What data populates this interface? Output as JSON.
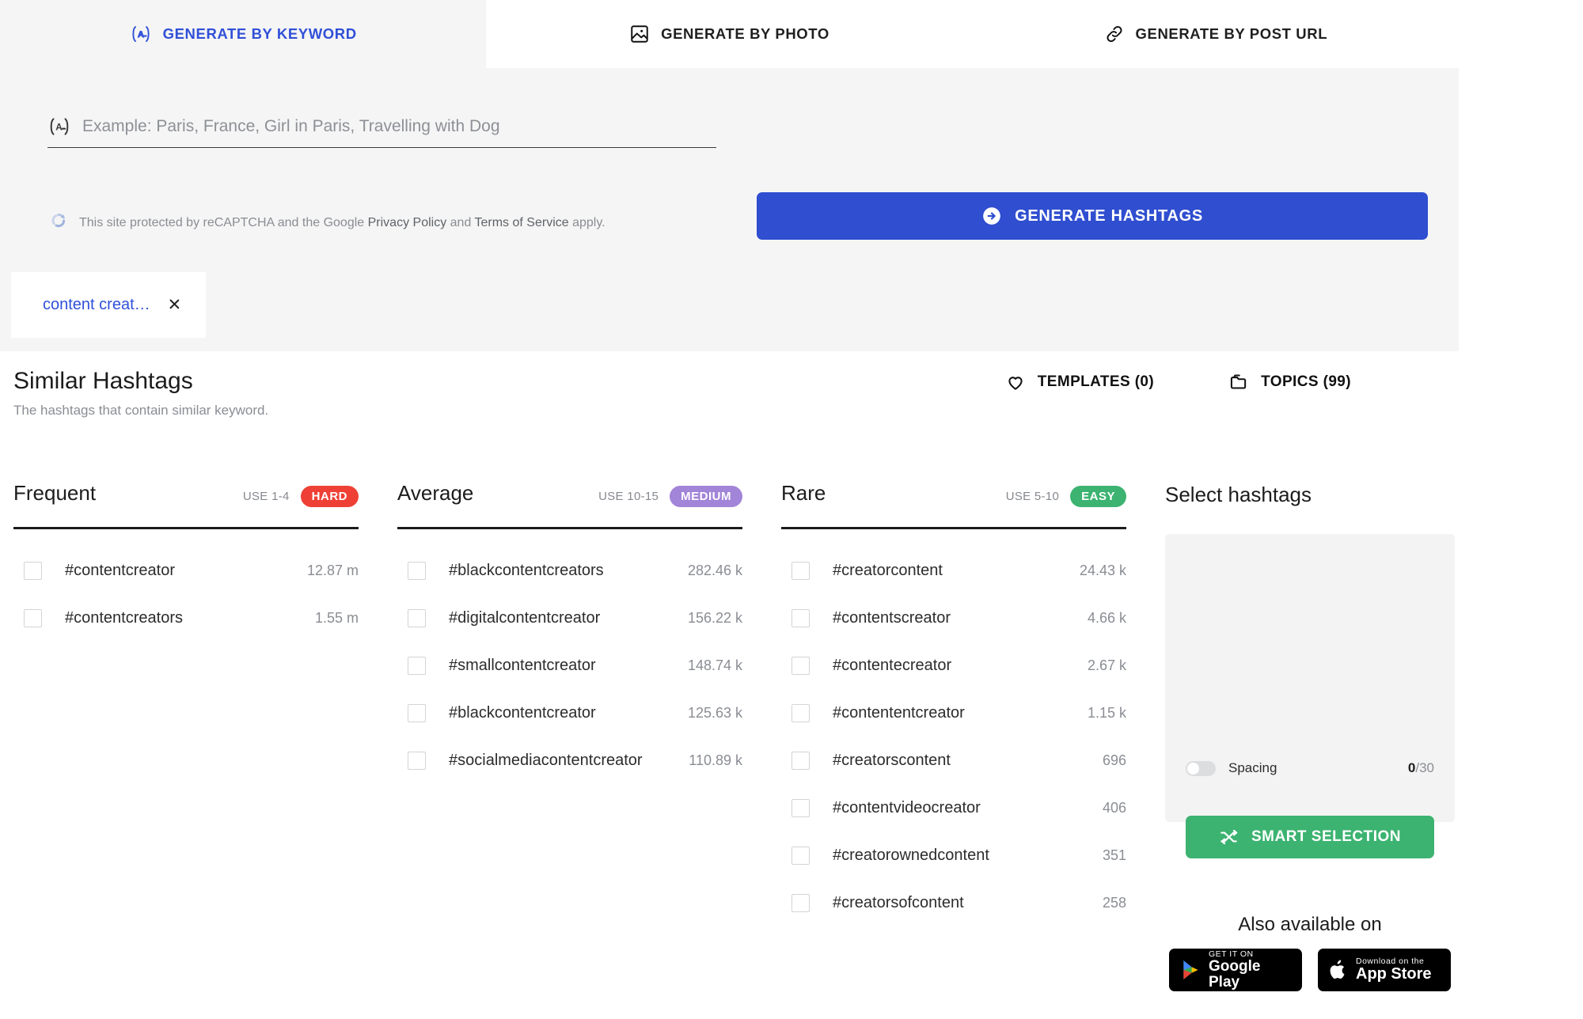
{
  "tabs": [
    {
      "label": "GENERATE BY KEYWORD",
      "icon": "keyword-icon",
      "active": true
    },
    {
      "label": "GENERATE BY PHOTO",
      "icon": "photo-icon",
      "active": false
    },
    {
      "label": "GENERATE BY POST URL",
      "icon": "link-icon",
      "active": false
    }
  ],
  "search": {
    "placeholder": "Example: Paris, France, Girl in Paris, Travelling with Dog",
    "value": "",
    "icon": "keyword-icon",
    "generate_label": "GENERATE HASHTAGS",
    "generate_icon": "arrow-right-circle-icon",
    "recaptcha": {
      "icon": "recaptcha-icon",
      "prefix": "This site protected by reCAPTCHA and the Google ",
      "privacy": "Privacy Policy",
      "middle": " and ",
      "terms": "Terms of Service",
      "suffix": " apply."
    }
  },
  "keyword_chip": {
    "label": "content creat…",
    "close_icon": "close-icon"
  },
  "results": {
    "title": "Similar Hashtags",
    "subtitle": "The hashtags that contain similar keyword.",
    "actions": [
      {
        "label": "TEMPLATES (0)",
        "icon": "heart-icon"
      },
      {
        "label": "TOPICS (99)",
        "icon": "folder-icon"
      }
    ]
  },
  "columns": [
    {
      "name": "Frequent",
      "use": "USE 1-4",
      "badge": "HARD",
      "badge_color": "#ef4035",
      "tags": [
        {
          "name": "#contentcreator",
          "count": "12.87 m"
        },
        {
          "name": "#contentcreators",
          "count": "1.55 m"
        }
      ]
    },
    {
      "name": "Average",
      "use": "USE 10-15",
      "badge": "MEDIUM",
      "badge_color": "#a284d8",
      "tags": [
        {
          "name": "#blackcontentcreators",
          "count": "282.46 k"
        },
        {
          "name": "#digitalcontentcreator",
          "count": "156.22 k"
        },
        {
          "name": "#smallcontentcreator",
          "count": "148.74 k"
        },
        {
          "name": "#blackcontentcreator",
          "count": "125.63 k"
        },
        {
          "name": "#socialmediacontentcreator",
          "count": "110.89 k"
        }
      ]
    },
    {
      "name": "Rare",
      "use": "USE 5-10",
      "badge": "EASY",
      "badge_color": "#3cb371",
      "tags": [
        {
          "name": "#creatorcontent",
          "count": "24.43 k"
        },
        {
          "name": "#contentscreator",
          "count": "4.66 k"
        },
        {
          "name": "#contentecreator",
          "count": "2.67 k"
        },
        {
          "name": "#contententcreator",
          "count": "1.15 k"
        },
        {
          "name": "#creatorscontent",
          "count": "696"
        },
        {
          "name": "#contentvideocreator",
          "count": "406"
        },
        {
          "name": "#creatorownedcontent",
          "count": "351"
        },
        {
          "name": "#creatorsofcontent",
          "count": "258"
        }
      ]
    }
  ],
  "select_panel": {
    "title": "Select hashtags",
    "spacing_label": "Spacing",
    "counter_current": "0",
    "counter_total": "/30",
    "smart_label": "SMART SELECTION",
    "smart_icon": "shuffle-icon",
    "also_title": "Also available on",
    "stores": [
      {
        "small": "GET IT ON",
        "big": "Google Play",
        "icon": "google-play-icon"
      },
      {
        "small": "Download on the",
        "big": "App Store",
        "icon": "apple-icon"
      }
    ]
  },
  "colors": {
    "accent_blue": "#2f4ed0",
    "link_blue": "#3050d8",
    "green": "#3cb371",
    "panel_gray": "#f5f5f5"
  }
}
